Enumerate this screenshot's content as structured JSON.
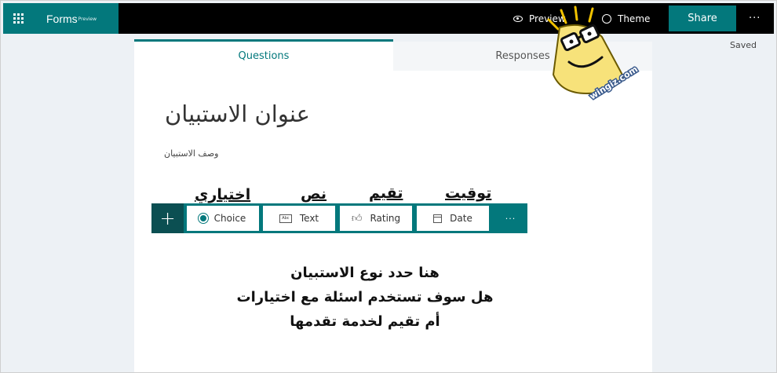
{
  "topbar": {
    "brand": "Forms",
    "brand_tag": "Preview",
    "preview_label": "Preview",
    "theme_label": "Theme",
    "share_label": "Share",
    "more_label": "···"
  },
  "status": {
    "saved": "Saved"
  },
  "tabs": {
    "questions": "Questions",
    "responses": "Responses",
    "active": "questions"
  },
  "form": {
    "title": "عنوان الاستبيان",
    "description": "وصف الاستبيان"
  },
  "toolbar": {
    "add_label": "+",
    "items": [
      {
        "label": "Choice",
        "icon": "radio-icon"
      },
      {
        "label": "Text",
        "icon": "text-icon"
      },
      {
        "label": "Rating",
        "icon": "thumbs-up-icon"
      },
      {
        "label": "Date",
        "icon": "calendar-icon"
      }
    ],
    "more_label": "···"
  },
  "annotations": {
    "choice": "اختياري",
    "text": "نص",
    "rating": "تقيم",
    "date": "توقيت"
  },
  "instructions": [
    "هنا حدد نوع الاستبيان",
    "هل سوف تستخدم اسئلة مع اختيارات",
    "أم تقيم لخدمة تقدمها"
  ],
  "watermark": {
    "text": "wingiz.com"
  },
  "colors": {
    "accent": "#03787c",
    "accent_dark": "#0b4f52",
    "topbar": "#000000",
    "background": "#edf1f5"
  }
}
